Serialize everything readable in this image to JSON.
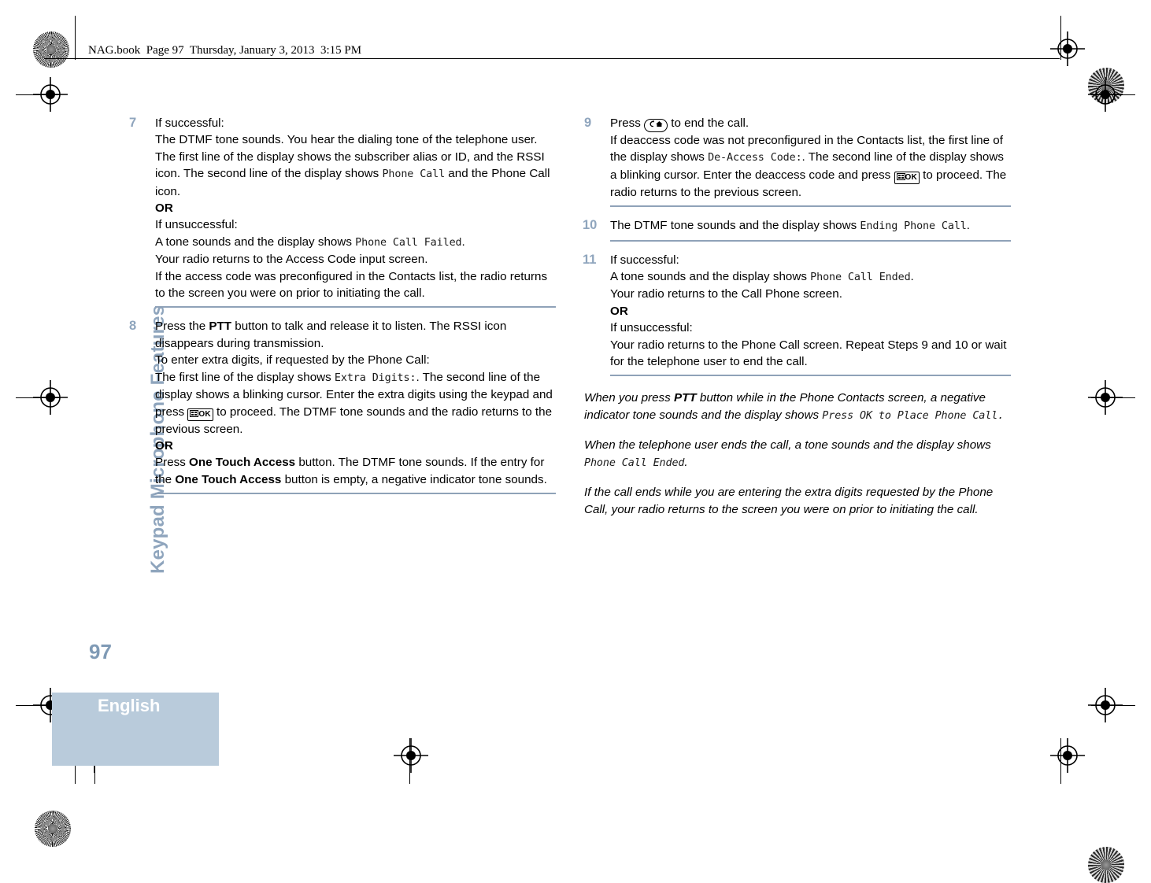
{
  "document": {
    "file_header": "NAG.book  Page 97  Thursday, January 3, 2013  3:15 PM",
    "chapter_tab": "Keypad Microphone Features",
    "page_number": "97",
    "language": "English"
  },
  "colors": {
    "accent": "#8fa5bd",
    "rule": "#8fa2b8",
    "band": "#b9cbdb"
  },
  "icons": {
    "ok_button": "OK",
    "ok_button_name": "menu-ok-key-icon",
    "back_home_name": "back-home-key-icon"
  },
  "left_column": {
    "steps": [
      {
        "number": "7",
        "lines": [
          "If successful:",
          "The DTMF tone sounds. You hear the dialing tone of the telephone user. The first line of the display shows the subscriber alias or ID, and the RSSI icon. The second line of the display shows ",
          "Phone Call",
          " and the Phone Call icon.",
          "OR",
          "If unsuccessful:",
          "A tone sounds and the display shows ",
          "Phone Call Failed",
          ".",
          "Your radio returns to the Access Code input screen.",
          "If the access code was preconfigured in the Contacts list, the radio returns to the screen you were on prior to initiating the call."
        ]
      },
      {
        "number": "8",
        "lines": [
          "Press the ",
          "PTT",
          " button to talk and release it to listen. The RSSI icon disappears during transmission.",
          "To enter extra digits, if requested by the Phone Call:",
          "The first line of the display shows ",
          "Extra Digits:",
          ". The second line of the display shows a blinking cursor. Enter the extra digits using the keypad and press ",
          " to proceed. The DTMF tone sounds and the radio returns to the previous screen.",
          "OR",
          "Press ",
          "One Touch Access",
          " button. The DTMF tone sounds. If the entry for the ",
          "One Touch Access",
          " button is empty, a negative indicator tone sounds."
        ]
      }
    ]
  },
  "right_column": {
    "steps": [
      {
        "number": "9",
        "lines": [
          "Press ",
          " to end the call.",
          "If deaccess code was not preconfigured in the Contacts list, the first line of the display shows ",
          "De-Access Code:",
          ". The second line of the display shows a blinking cursor. Enter the deaccess code and press ",
          " to proceed. The radio returns to the previous screen."
        ]
      },
      {
        "number": "10",
        "lines": [
          "The DTMF tone sounds and the display shows ",
          "Ending Phone Call",
          "."
        ]
      },
      {
        "number": "11",
        "lines": [
          "If successful:",
          "A tone sounds and the display shows ",
          "Phone Call Ended",
          ".",
          "Your radio returns to the Call Phone screen.",
          "OR",
          "If unsuccessful:",
          "Your radio returns to the Phone Call screen. Repeat Steps 9 and 10 or wait for the telephone user to end the call."
        ]
      }
    ],
    "notes": [
      {
        "pre": "When you press ",
        "bold": "PTT",
        "mid": " button while in the Phone Contacts screen, a negative indicator tone sounds and the display shows ",
        "mono": "Press OK to Place Phone Call.",
        "post": ""
      },
      {
        "pre": "When the telephone user ends the call, a tone sounds and the display shows ",
        "bold": "",
        "mid": "",
        "mono": "Phone Call Ended",
        "post": "."
      },
      {
        "pre": "If the call ends while you are entering the extra digits requested by the Phone Call, your radio returns to the screen you were on prior to initiating the call.",
        "bold": "",
        "mid": "",
        "mono": "",
        "post": ""
      }
    ]
  }
}
